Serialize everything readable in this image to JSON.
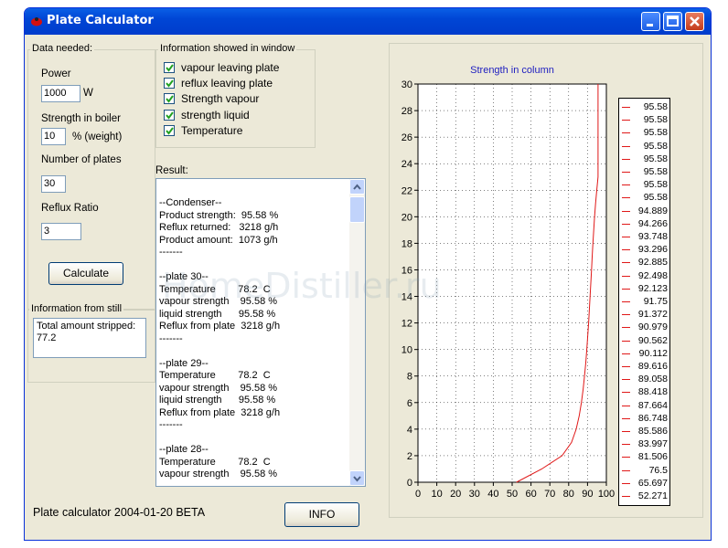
{
  "window": {
    "title": "Plate Calculator"
  },
  "data_needed": {
    "legend": "Data needed:",
    "power_label": "Power",
    "power_value": "1000",
    "power_unit": "W",
    "strength_label": "Strength in  boiler",
    "strength_value": "10",
    "strength_unit": "% (weight)",
    "plates_label": "Number of plates",
    "plates_value": "30",
    "reflux_label": "Reflux Ratio",
    "reflux_value": "3",
    "calculate_label": "Calculate"
  },
  "info_window": {
    "legend": "Information showed in window",
    "options": [
      {
        "label": "vapour leaving plate",
        "checked": true
      },
      {
        "label": "reflux leaving plate",
        "checked": true
      },
      {
        "label": "Strength vapour",
        "checked": true
      },
      {
        "label": "strength liquid",
        "checked": true
      },
      {
        "label": "Temperature",
        "checked": true
      }
    ]
  },
  "result": {
    "label": "Result:",
    "lines": [
      "--Condenser--",
      "Product strength:  95.58 %",
      "Reflux returned:   3218 g/h",
      "Product amount:  1073 g/h",
      "-------",
      "",
      "--plate 30--",
      "Temperature        78.2  C",
      "vapour strength    95.58 %",
      "liquid strength      95.58 %",
      "Reflux from plate  3218 g/h",
      "-------",
      "",
      "--plate 29--",
      "Temperature        78.2  C",
      "vapour strength    95.58 %",
      "liquid strength      95.58 %",
      "Reflux from plate  3218 g/h",
      "-------",
      "",
      "--plate 28--",
      "Temperature        78.2  C",
      "vapour strength    95.58 %"
    ]
  },
  "still": {
    "legend": "Information from still",
    "text": "Total amount stripped: 77.2"
  },
  "footer": {
    "status": "Plate calculator 2004-01-20 BETA",
    "info_label": "INFO"
  },
  "watermark": "HomeDistiller.ru",
  "colors": {
    "titlebar": "#0046d5",
    "series": "#e01818",
    "chart_title": "#2020c0"
  },
  "chart_data": {
    "type": "line",
    "title": "Strength in column",
    "xlabel": "",
    "ylabel": "",
    "xlim": [
      0,
      100
    ],
    "ylim": [
      0,
      30
    ],
    "xticks": [
      0,
      10,
      20,
      30,
      40,
      50,
      60,
      70,
      80,
      90,
      100
    ],
    "yticks": [
      0,
      2,
      4,
      6,
      8,
      10,
      12,
      14,
      16,
      18,
      20,
      22,
      24,
      26,
      28,
      30
    ],
    "grid": true,
    "legend_position": "right",
    "series": [
      {
        "x": [
          52.271,
          65.697,
          76.5,
          81.506,
          83.997,
          85.586,
          86.748,
          87.664,
          88.418,
          89.058,
          89.616,
          90.112,
          90.562,
          90.979,
          91.372,
          91.75,
          92.123,
          92.498,
          92.885,
          93.296,
          93.748,
          94.266,
          94.889,
          95.58,
          95.58,
          95.58,
          95.58,
          95.58,
          95.58,
          95.58,
          95.58
        ],
        "y": [
          0,
          1,
          2,
          3,
          4,
          5,
          6,
          7,
          8,
          9,
          10,
          11,
          12,
          13,
          14,
          15,
          16,
          17,
          18,
          19,
          20,
          21,
          22,
          23,
          24,
          25,
          26,
          27,
          28,
          29,
          30
        ]
      }
    ],
    "legend_values": [
      "95.58",
      "95.58",
      "95.58",
      "95.58",
      "95.58",
      "95.58",
      "95.58",
      "95.58",
      "94.889",
      "94.266",
      "93.748",
      "93.296",
      "92.885",
      "92.498",
      "92.123",
      "91.75",
      "91.372",
      "90.979",
      "90.562",
      "90.112",
      "89.616",
      "89.058",
      "88.418",
      "87.664",
      "86.748",
      "85.586",
      "83.997",
      "81.506",
      "76.5",
      "65.697",
      "52.271"
    ]
  }
}
